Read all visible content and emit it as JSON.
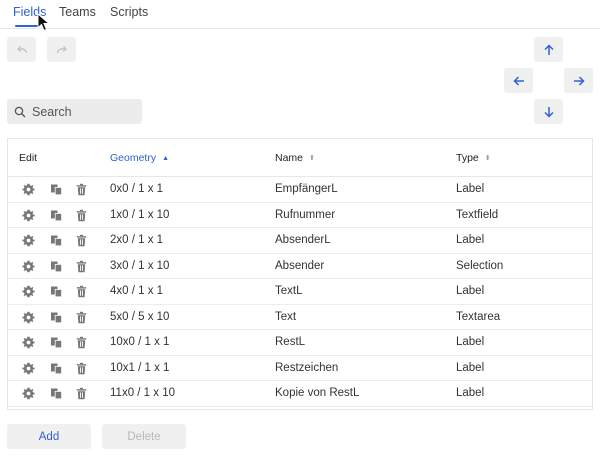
{
  "tabs": [
    {
      "label": "Fields",
      "active": true
    },
    {
      "label": "Teams",
      "active": false
    },
    {
      "label": "Scripts",
      "active": false
    }
  ],
  "toolbar": {
    "undo_icon": "undo-icon",
    "redo_icon": "redo-icon",
    "move_up_icon": "arrow-up-icon",
    "move_left_icon": "arrow-left-icon",
    "move_right_icon": "arrow-right-icon",
    "move_down_icon": "arrow-down-icon"
  },
  "search": {
    "placeholder": "Search",
    "value": ""
  },
  "table": {
    "columns": {
      "edit": "Edit",
      "geometry": "Geometry",
      "name": "Name",
      "type": "Type"
    },
    "sorted_column": "geometry",
    "sort_direction": "ascending",
    "sort_asc_glyph": "▲",
    "sort_both_glyph": "⬍",
    "row_actions": [
      "settings-icon",
      "copy-icon",
      "trash-icon"
    ],
    "rows": [
      {
        "geometry": "0x0 / 1 x 1",
        "name": "EmpfängerL",
        "type": "Label"
      },
      {
        "geometry": "1x0 / 1 x 10",
        "name": "Rufnummer",
        "type": "Textfield"
      },
      {
        "geometry": "2x0 / 1 x 1",
        "name": "AbsenderL",
        "type": "Label"
      },
      {
        "geometry": "3x0 / 1 x 10",
        "name": "Absender",
        "type": "Selection"
      },
      {
        "geometry": "4x0 / 1 x 1",
        "name": "TextL",
        "type": "Label"
      },
      {
        "geometry": "5x0 / 5 x 10",
        "name": "Text",
        "type": "Textarea"
      },
      {
        "geometry": "10x0 / 1 x 1",
        "name": "RestL",
        "type": "Label"
      },
      {
        "geometry": "10x1 / 1 x 1",
        "name": "Restzeichen",
        "type": "Label"
      },
      {
        "geometry": "11x0 / 1 x 10",
        "name": "Kopie von RestL",
        "type": "Label"
      }
    ]
  },
  "buttons": {
    "add": "Add",
    "delete": "Delete"
  },
  "colors": {
    "accent": "#2f62d6",
    "disabled": "#b8b8b8",
    "icon": "#777777"
  }
}
